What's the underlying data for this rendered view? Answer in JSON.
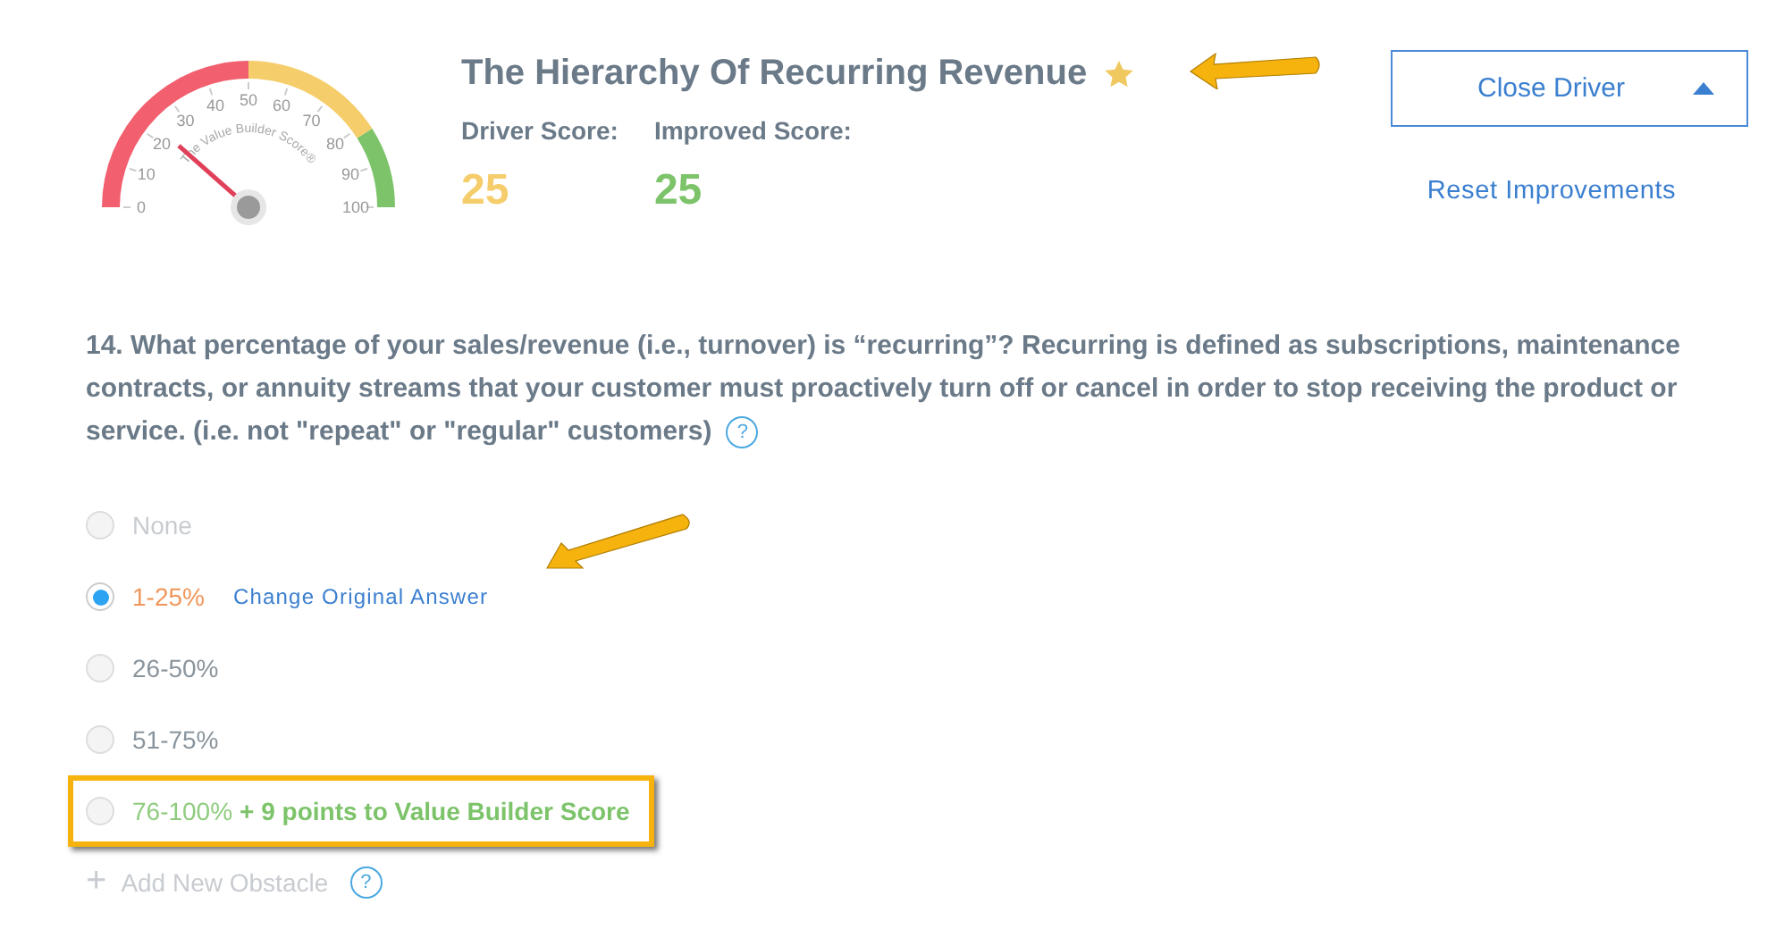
{
  "gauge": {
    "caption": "The Value Builder Score®",
    "ticks": [
      "0",
      "10",
      "20",
      "30",
      "40",
      "50",
      "60",
      "70",
      "80",
      "90",
      "100"
    ]
  },
  "driver": {
    "title": "The Hierarchy Of Recurring Revenue",
    "starred": true,
    "driver_score_label": "Driver Score:",
    "driver_score": "25",
    "improved_score_label": "Improved Score:",
    "improved_score": "25"
  },
  "close_button": {
    "label": "Close Driver",
    "expanded": true
  },
  "reset_link": "Reset Improvements",
  "question": {
    "text": "14. What percentage of your sales/revenue (i.e., turnover) is “recurring”? Recurring is defined as subscriptions, maintenance contracts, or annuity streams that your customer must proactively turn off or cancel in order to stop receiving the product or service. (i.e. not \"repeat\" or \"regular\" customers)",
    "help": "?"
  },
  "options": [
    {
      "label": "None",
      "kind": "disabled",
      "selected": false
    },
    {
      "label": "1-25%",
      "kind": "original",
      "selected": true,
      "link": "Change Original Answer"
    },
    {
      "label": "26-50%",
      "kind": "normal",
      "selected": false
    },
    {
      "label": "51-75%",
      "kind": "normal",
      "selected": false
    },
    {
      "label": "76-100%",
      "kind": "improved",
      "selected": false,
      "bonus": "+ 9 points to Value Builder Score",
      "highlighted": true
    }
  ],
  "add_obstacle": {
    "icon": "+",
    "label": "Add New Obstacle",
    "help": "?"
  }
}
